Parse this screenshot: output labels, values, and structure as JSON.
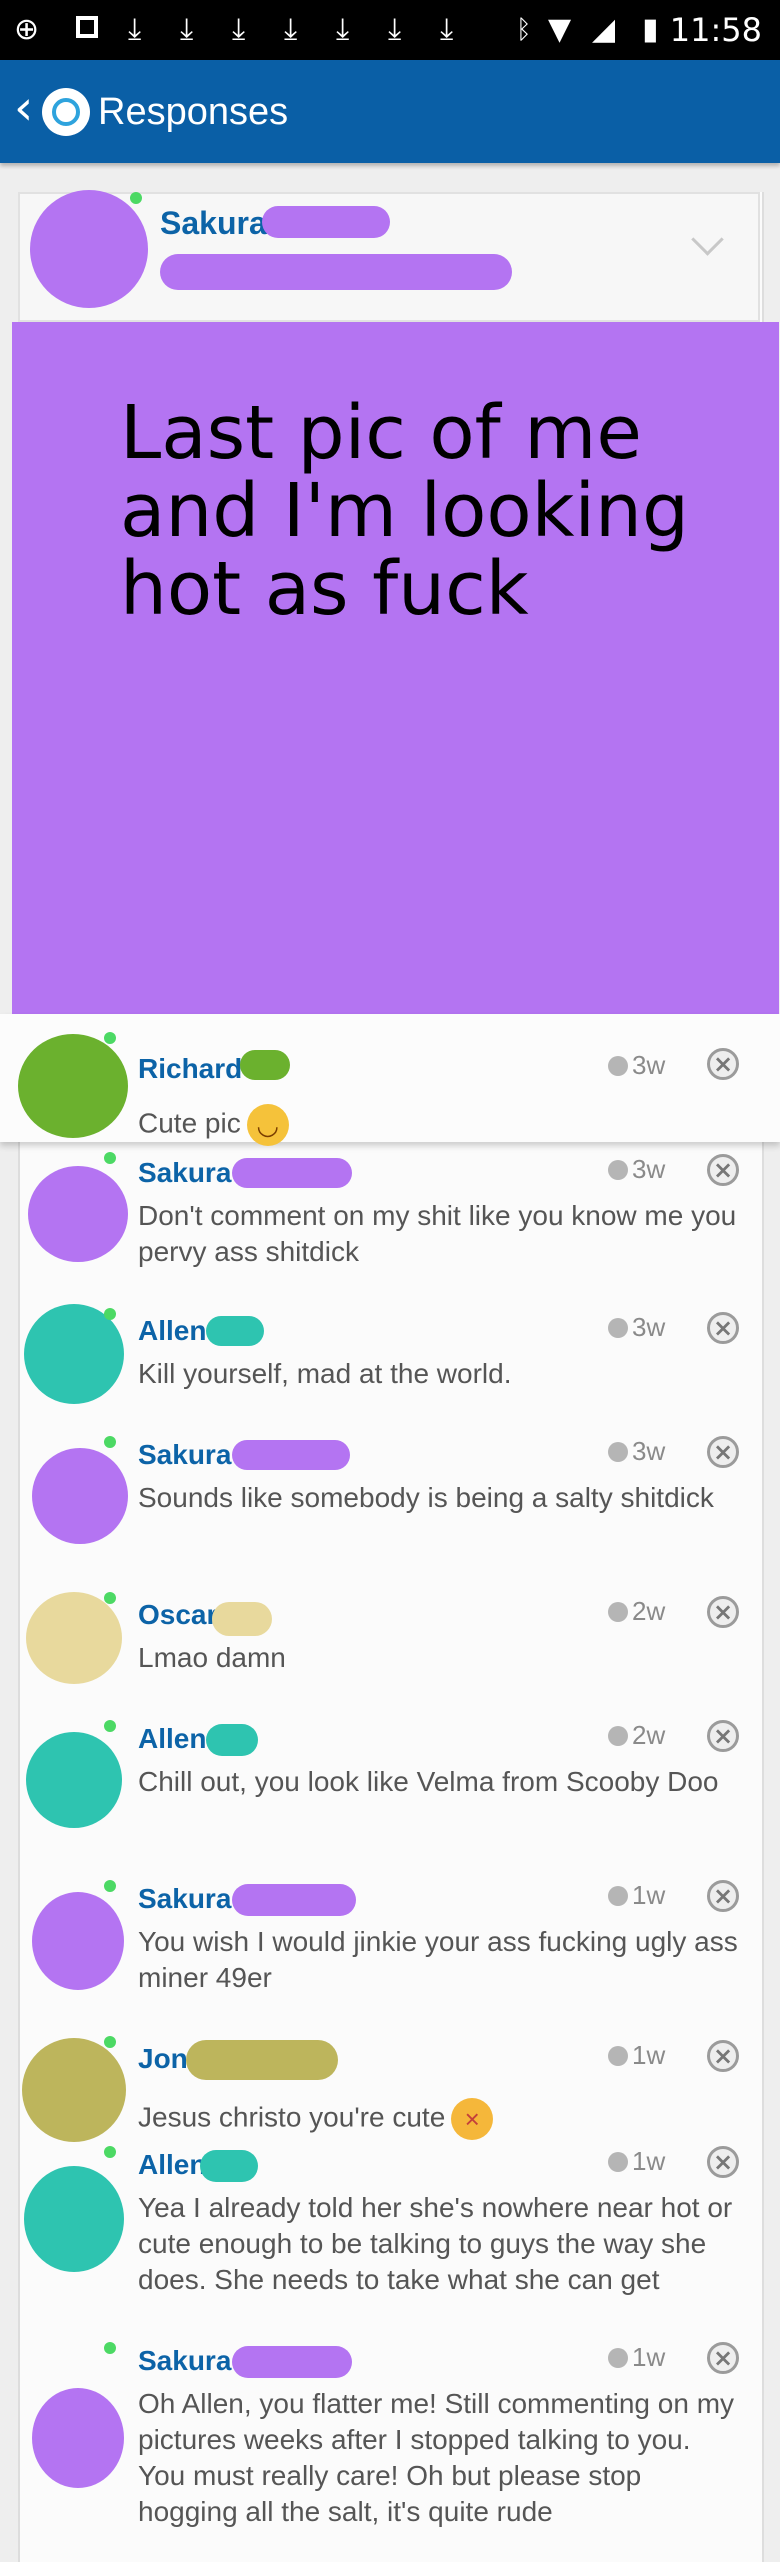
{
  "status_bar": {
    "time": "11:58"
  },
  "app_bar": {
    "title": "Responses"
  },
  "post": {
    "author": "Sakura",
    "caption": "Last pic of me\nand I'm looking\nhot as fuck",
    "image_color": "#b474f2"
  },
  "comments": [
    {
      "name": "Richard",
      "time": "3w",
      "text": "Cute pic",
      "emoji": "grinning-face",
      "avatar_color": "#6bb12e"
    },
    {
      "name": "Sakura",
      "time": "3w",
      "text": "Don't comment on my shit like you know me you pervy ass shitdick",
      "avatar_color": "#b474f2"
    },
    {
      "name": "Allen",
      "time": "3w",
      "text": "Kill yourself, mad at the world.",
      "avatar_color": "#2ec4b0"
    },
    {
      "name": "Sakura",
      "time": "3w",
      "text": "Sounds like somebody is being a salty shitdick",
      "avatar_color": "#b474f2"
    },
    {
      "name": "Oscar",
      "time": "2w",
      "text": "Lmao damn",
      "avatar_color": "#e8d99d"
    },
    {
      "name": "Allen",
      "time": "2w",
      "text": "Chill out, you look like Velma from Scooby Doo",
      "avatar_color": "#2ec4b0"
    },
    {
      "name": "Sakura",
      "time": "1w",
      "text": "You wish I would jinkie your ass fucking ugly ass miner 49er",
      "avatar_color": "#b474f2"
    },
    {
      "name": "Jon",
      "time": "1w",
      "text": "Jesus christo you're cute",
      "emoji": "squinting-tongue-face",
      "avatar_color": "#bdb55c"
    },
    {
      "name": "Allen",
      "time": "1w",
      "text": "Yea I already told her she's nowhere near hot or cute enough to be talking to guys the way she does. She needs to take what she can get",
      "avatar_color": "#2ec4b0"
    },
    {
      "name": "Sakura",
      "time": "1w",
      "text": "Oh Allen, you flatter me! Still commenting on my pictures weeks after I stopped talking to you. You must really care! Oh but please stop hogging all the salt, it's quite rude",
      "avatar_color": "#b474f2"
    }
  ]
}
